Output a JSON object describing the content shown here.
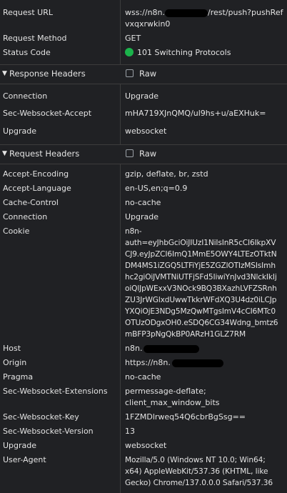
{
  "general": {
    "request_url_label": "Request URL",
    "request_url_line1_prefix": "wss://n8n.",
    "request_url_line1_suffix": "/rest/push?pushRef",
    "request_url_line2": "vxqxrwkin0",
    "request_method_label": "Request Method",
    "request_method_value": "GET",
    "status_code_label": "Status Code",
    "status_code_value": "101 Switching Protocols",
    "status_color": "#1bb34b"
  },
  "response_headers": {
    "title": "Response Headers",
    "raw_label": "Raw",
    "items": [
      {
        "key": "Connection",
        "value": "Upgrade"
      },
      {
        "key": "Sec-Websocket-Accept",
        "value": "mHA719XJnQMQ/ul9hs+u/aEXHuk="
      },
      {
        "key": "Upgrade",
        "value": "websocket"
      }
    ]
  },
  "request_headers": {
    "title": "Request Headers",
    "raw_label": "Raw",
    "accept_encoding": {
      "key": "Accept-Encoding",
      "value": "gzip, deflate, br, zstd"
    },
    "accept_language": {
      "key": "Accept-Language",
      "value": "en-US,en;q=0.9"
    },
    "cache_control": {
      "key": "Cache-Control",
      "value": "no-cache"
    },
    "connection": {
      "key": "Connection",
      "value": "Upgrade"
    },
    "cookie": {
      "key": "Cookie",
      "lines": [
        "n8n-",
        "auth=eyJhbGciOiJIUzI1NiIsInR5cCI6IkpXV",
        "CJ9.eyJpZCI6ImQ1MmE5OWY4LTEzOTktN",
        "DM4MS1iZGQ5LTFiYjE5ZGZlOTIzMSIsImh",
        "hc2giOiJVMTNiUTFjSFd5IiwiYnJvd3NlckIkIj",
        "oiQlJpWExxV3NOck9BQ3BXazhLVFZSRnh",
        "ZU3JrWGlxdUwwTkkrWFdXQ3U4dz0iLCJp",
        "YXQiOjE3NDg5MzQwMTgsImV4cCI6MTc0",
        "OTUzODgxOH0.eSDQ6CG34Wdng_bmtz6",
        "mBFP3pNgQkBP0ARzH1GLZ7RM"
      ]
    },
    "host": {
      "key": "Host",
      "value_prefix": "n8n."
    },
    "origin": {
      "key": "Origin",
      "value_prefix": "https://n8n."
    },
    "pragma": {
      "key": "Pragma",
      "value": "no-cache"
    },
    "extensions": {
      "key": "Sec-Websocket-Extensions",
      "line1": "permessage-deflate;",
      "line2": "client_max_window_bits"
    },
    "ws_key": {
      "key": "Sec-Websocket-Key",
      "value": "1FZMDlrweq54Q6cbrBgSsg=="
    },
    "ws_version": {
      "key": "Sec-Websocket-Version",
      "value": "13"
    },
    "upgrade": {
      "key": "Upgrade",
      "value": "websocket"
    },
    "user_agent": {
      "key": "User-Agent",
      "line1": "Mozilla/5.0 (Windows NT 10.0; Win64;",
      "line2": "x64) AppleWebKit/537.36 (KHTML, like",
      "line3": "Gecko) Chrome/137.0.0.0 Safari/537.36"
    }
  }
}
